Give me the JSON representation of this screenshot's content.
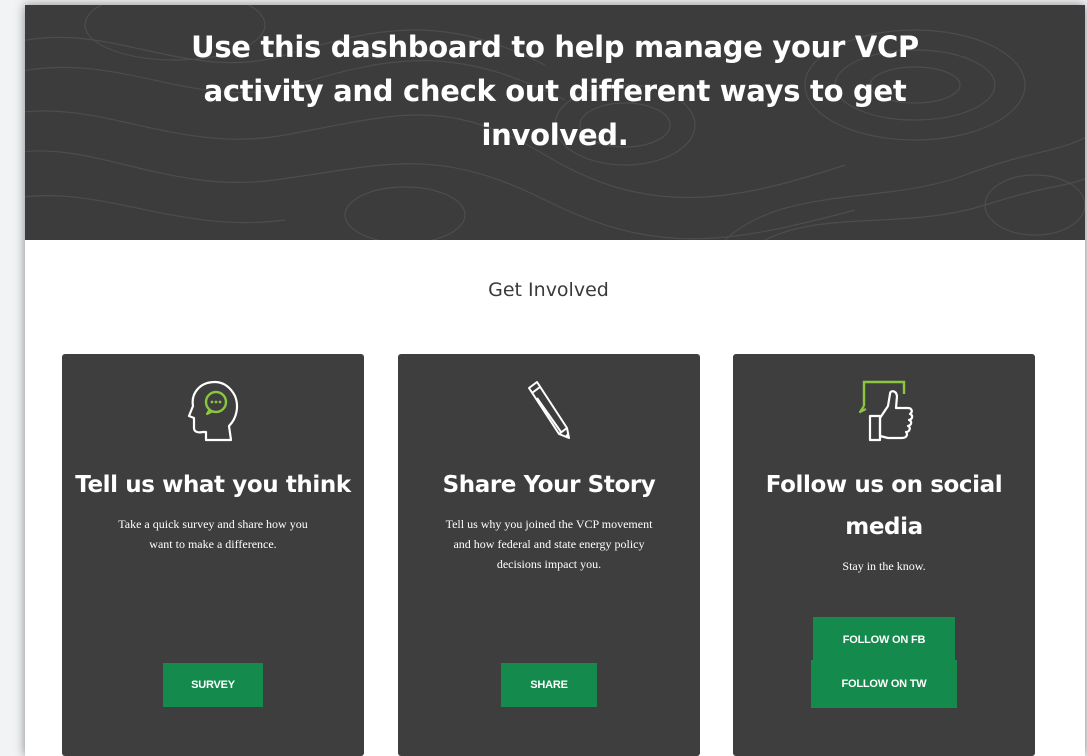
{
  "hero": {
    "headline_line1": "Use this dashboard to help manage your VCP",
    "headline_line2": "activity and check out different ways to get",
    "headline_line3": "involved."
  },
  "section": {
    "title": "Get Involved"
  },
  "cards": [
    {
      "icon": "speech-head-icon",
      "title": "Tell us what you think",
      "desc_line1": "Take a quick survey and share how you",
      "desc_line2": "want to make a difference.",
      "button": "SURVEY"
    },
    {
      "icon": "pencil-icon",
      "title": "Share Your Story",
      "desc_line1": "Tell us why you joined the VCP movement",
      "desc_line2": "and how federal and state energy policy",
      "desc_line3": "decisions impact you.",
      "button": "SHARE"
    },
    {
      "icon": "thumbs-up-icon",
      "title_line1": "Follow us on social",
      "title_line2": "media",
      "desc_line1": "Stay in the know.",
      "button_fb": "FOLLOW ON FB",
      "button_tw": "FOLLOW ON TW"
    }
  ],
  "colors": {
    "accent_green": "#148a4c",
    "icon_green": "#8cc63f",
    "card_bg": "#3e3e3e",
    "hero_bg": "#3c3c3c"
  }
}
